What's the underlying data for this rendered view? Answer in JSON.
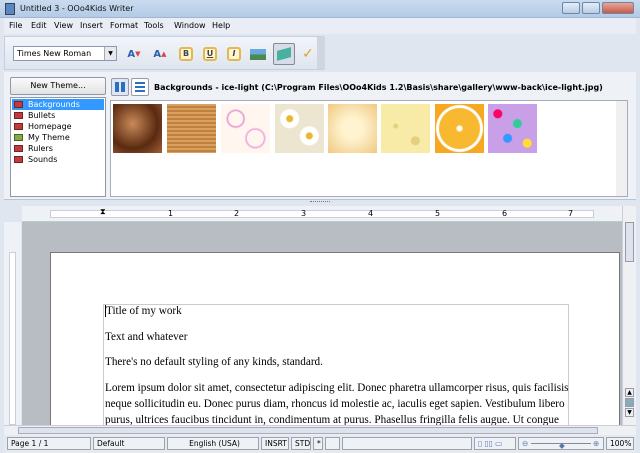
{
  "window": {
    "title": "Untitled 3 - OOo4Kids Writer"
  },
  "menu": [
    "File",
    "Edit",
    "View",
    "Insert",
    "Format",
    "Tools",
    "Window",
    "Help"
  ],
  "toolbar": {
    "font_name": "Times New Roman",
    "bold": "B",
    "underline": "U",
    "italic": "I"
  },
  "gallery": {
    "new_theme": "New Theme...",
    "themes": [
      "Backgrounds",
      "Bullets",
      "Homepage",
      "My Theme",
      "Rulers",
      "Sounds"
    ],
    "selected": "Backgrounds",
    "title": "Backgrounds - ice-light (C:\\Program Files\\OOo4Kids 1.2\\Basis\\share\\gallery\\www-back\\ice-light.jpg)",
    "thumbnails": [
      "brown-swirl",
      "wood",
      "pink-circles",
      "daisies",
      "popcorn",
      "cheese",
      "orange",
      "confetti"
    ]
  },
  "ruler": {
    "labels": [
      "1",
      "2",
      "3",
      "4",
      "5",
      "6",
      "7"
    ]
  },
  "document": {
    "lines": [
      "Title of my work",
      "Text and whatever",
      "There's no default styling of any kinds, standard.",
      "Lorem ipsum dolor sit amet, consectetur adipiscing elit. Donec pharetra ullamcorper risus, quis facilisis",
      "neque sollicitudin eu. Donec purus diam, rhoncus id molestie ac, iaculis eget sapien. Vestibulum libero",
      "purus, ultrices faucibus tincidunt in, condimentum at purus. Phasellus fringilla felis augue. Ut congue"
    ]
  },
  "status": {
    "page": "Page 1 / 1",
    "style": "Default",
    "language": "English (USA)",
    "insert": "INSRT",
    "selection": "STD",
    "modified": "*",
    "zoom": "100%",
    "zoom_level": 100
  }
}
